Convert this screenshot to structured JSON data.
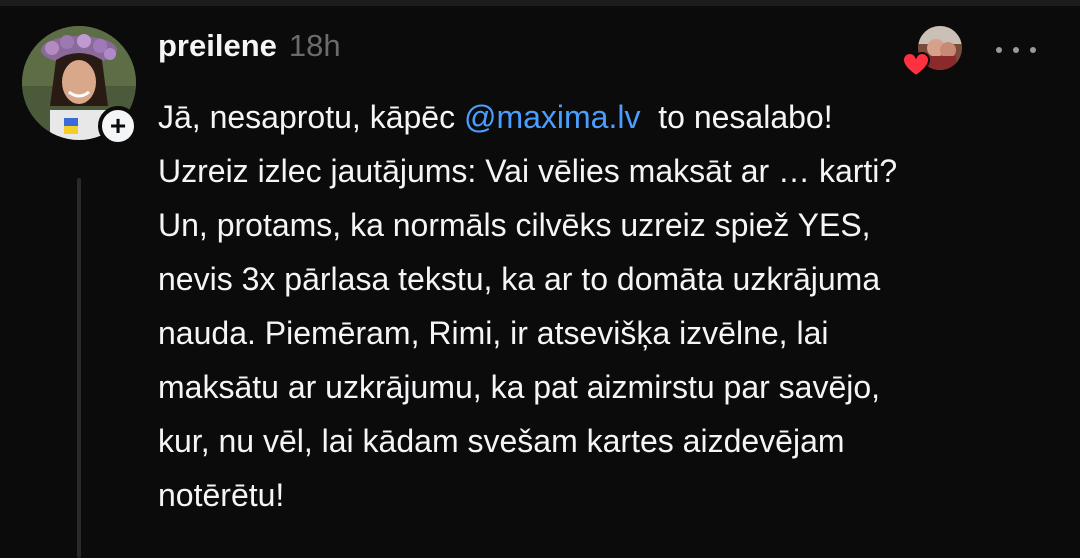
{
  "post": {
    "username": "preilene",
    "timestamp": "18h",
    "body_before": "Jā, nesaprotu, kāpēc ",
    "mention": "@maxima.lv",
    "body_after": "  to nesalabo!\nUzreiz izlec jautājums: Vai vēlies maksāt ar … karti?\nUn, protams, ka normāls cilvēks uzreiz spiež YES,\nnevis 3x pārlasa tekstu, ka ar to domāta uzkrājuma\nnauda. Piemēram, Rimi, ir atsevišķa izvēlne, lai\nmaksātu ar uzkrājumu, ka pat aizmirstu par savējo,\nkur, nu vēl, lai kādam svešam kartes aizdevējam\nnotērētu!"
  },
  "follow_badge": "+",
  "icons": {
    "follow": "plus-icon",
    "like": "heart-icon",
    "menu": "more-dots-icon"
  },
  "colors": {
    "background": "#0b0b0b",
    "text": "#f3f5f7",
    "muted": "#6b6b6b",
    "mention": "#4a9eff",
    "heart": "#ff3040"
  }
}
